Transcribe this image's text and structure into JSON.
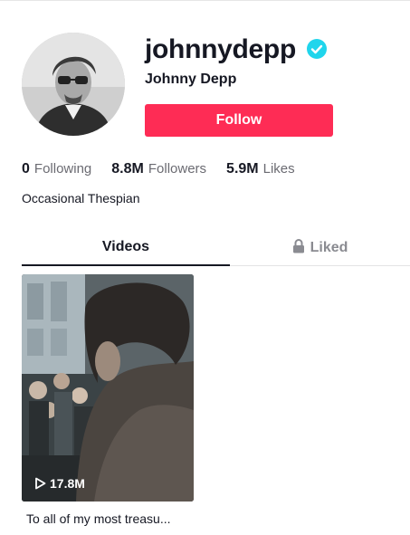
{
  "profile": {
    "username": "johnnydepp",
    "display_name": "Johnny Depp",
    "verified": true,
    "follow_label": "Follow",
    "bio": "Occasional Thespian",
    "avatar_icon": "avatar-photo",
    "verified_icon": "verified-badge-icon"
  },
  "stats": {
    "following": {
      "value": "0",
      "label": "Following"
    },
    "followers": {
      "value": "8.8M",
      "label": "Followers"
    },
    "likes": {
      "value": "5.9M",
      "label": "Likes"
    }
  },
  "tabs": {
    "videos": "Videos",
    "liked": "Liked"
  },
  "videos": [
    {
      "views": "17.8M",
      "caption": "To all of my most treasu..."
    }
  ],
  "colors": {
    "accent": "#fe2c55",
    "verified": "#20d5ec",
    "text": "#161823",
    "muted": "#8a8b91"
  }
}
